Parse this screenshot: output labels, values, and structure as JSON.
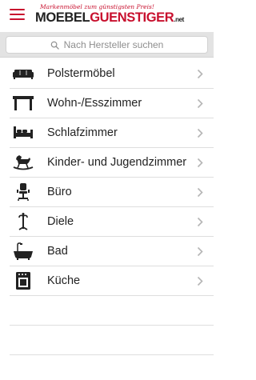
{
  "header": {
    "menu_icon": "hamburger-menu-icon",
    "logo_tagline": "Markenmöbel zum günstigsten Preis!",
    "logo_part1": "MOEBEL",
    "logo_part2": "GUENSTIGER",
    "logo_part3": ".net",
    "brand_color": "#c8102e"
  },
  "search": {
    "placeholder": "Nach Hersteller suchen",
    "icon": "search-icon"
  },
  "categories": [
    {
      "label": "Polstermöbel",
      "icon": "sofa-icon"
    },
    {
      "label": "Wohn-/Esszimmer",
      "icon": "dining-table-icon"
    },
    {
      "label": "Schlafzimmer",
      "icon": "bed-icon"
    },
    {
      "label": "Kinder- und Jugendzimmer",
      "icon": "rocking-horse-icon"
    },
    {
      "label": "Büro",
      "icon": "office-chair-icon"
    },
    {
      "label": "Diele",
      "icon": "coat-stand-icon"
    },
    {
      "label": "Bad",
      "icon": "bathtub-icon"
    },
    {
      "label": "Küche",
      "icon": "stove-icon"
    }
  ]
}
